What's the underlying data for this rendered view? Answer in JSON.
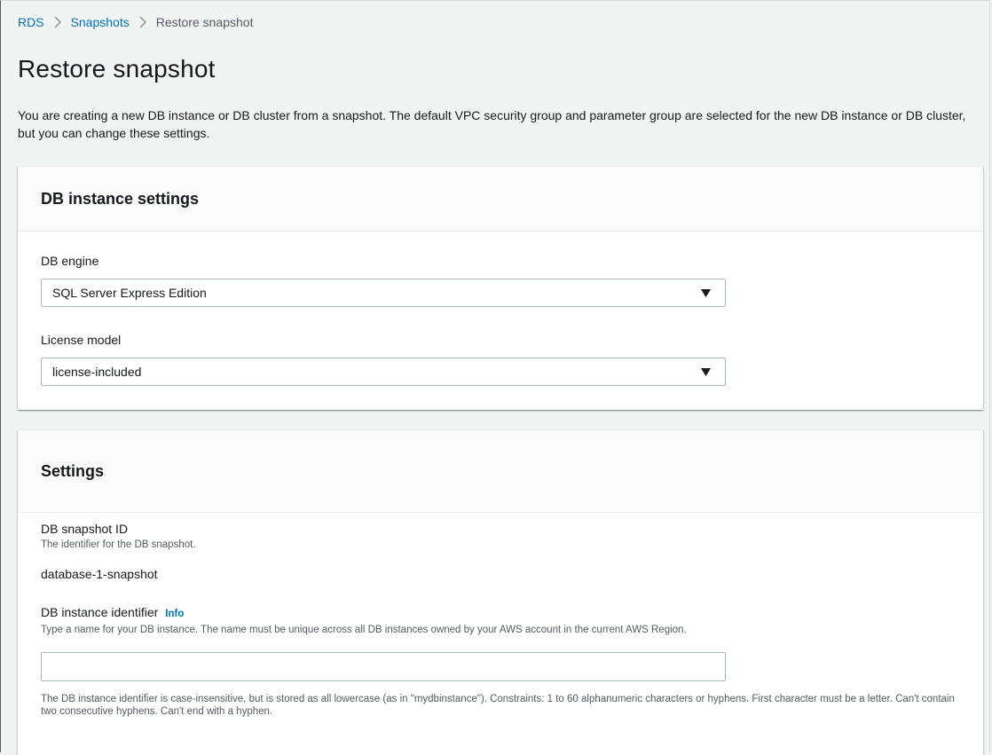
{
  "breadcrumb": {
    "items": [
      {
        "label": "RDS"
      },
      {
        "label": "Snapshots"
      },
      {
        "label": "Restore snapshot"
      }
    ]
  },
  "page": {
    "title": "Restore snapshot",
    "intro": "You are creating a new DB instance or DB cluster from a snapshot. The default VPC security group and parameter group are selected for the new DB instance or DB cluster, but you can change these settings."
  },
  "db_instance_settings": {
    "title": "DB instance settings",
    "engine_label": "DB engine",
    "engine_value": "SQL Server Express Edition",
    "license_label": "License model",
    "license_value": "license-included"
  },
  "settings": {
    "title": "Settings",
    "snapshot_id_label": "DB snapshot ID",
    "snapshot_id_desc": "The identifier for the DB snapshot.",
    "snapshot_id_value": "database-1-snapshot",
    "identifier_label": "DB instance identifier",
    "identifier_info": "Info",
    "identifier_desc": "Type a name for your DB instance. The name must be unique across all DB instances owned by your AWS account in the current AWS Region.",
    "identifier_value": "",
    "identifier_constraint": "The DB instance identifier is case-insensitive, but is stored as all lowercase (as in \"mydbinstance\"). Constraints: 1 to 60 alphanumeric characters or hyphens. First character must be a letter. Can't contain two consecutive hyphens. Can't end with a hyphen."
  },
  "icons": {
    "breadcrumb_separator": "chevron-right-icon",
    "select_caret": "caret-down-icon"
  },
  "colors": {
    "link": "#0073bb",
    "background": "#f2f3f3",
    "panel_header": "#fafafa",
    "text": "#16191f",
    "secondary_text": "#545b64"
  }
}
